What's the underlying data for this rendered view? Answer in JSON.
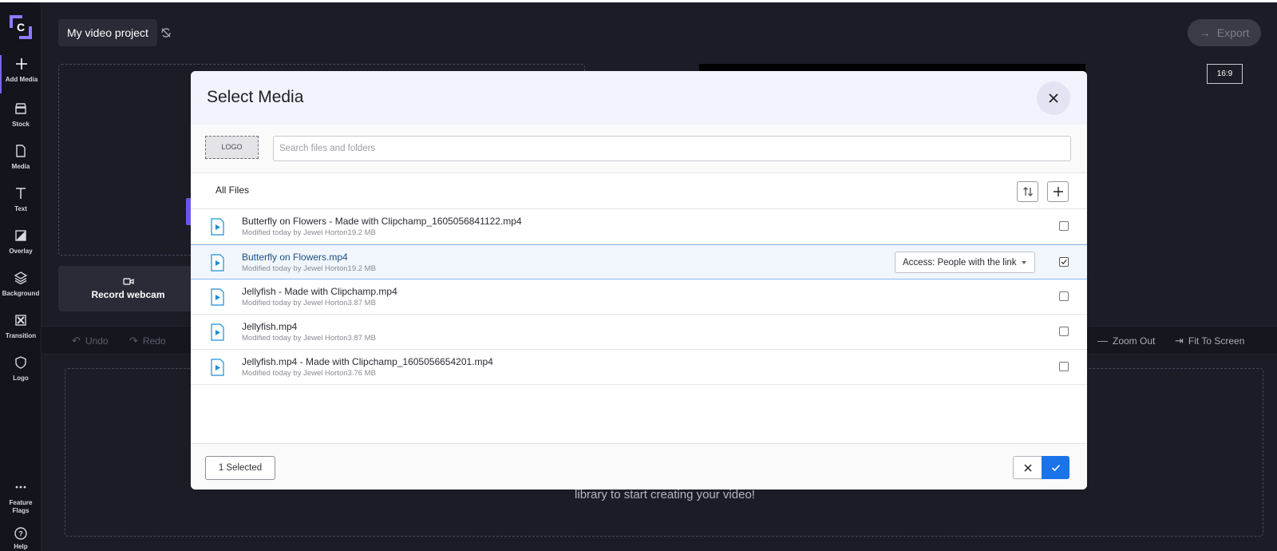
{
  "app": {
    "project_title": "My video project",
    "export_label": "Export",
    "aspect_ratio": "16:9",
    "accent_color": "#7b61ff"
  },
  "sidebar": {
    "items": [
      {
        "label": "Add Media",
        "icon": "plus-icon"
      },
      {
        "label": "Stock",
        "icon": "stock-icon"
      },
      {
        "label": "Media",
        "icon": "file-icon"
      },
      {
        "label": "Text",
        "icon": "text-icon"
      },
      {
        "label": "Overlay",
        "icon": "overlay-icon"
      },
      {
        "label": "Background",
        "icon": "layers-icon"
      },
      {
        "label": "Transition",
        "icon": "transition-icon"
      },
      {
        "label": "Logo",
        "icon": "shield-icon"
      }
    ],
    "feature_flags_label": "Feature Flags",
    "help_label": "Help"
  },
  "workspace": {
    "record_webcam_label": "Record webcam",
    "toolbar": {
      "undo": "Undo",
      "redo": "Redo",
      "zoom_out": "Zoom Out",
      "fit_to_screen": "Fit To Screen"
    },
    "timeline_hint": "library to start creating your video!"
  },
  "modal": {
    "title": "Select Media",
    "logo_placeholder": "LOGO",
    "search_placeholder": "Search files and folders",
    "breadcrumb": "All Files",
    "files": [
      {
        "name": "Butterfly on Flowers - Made with Clipchamp_1605056841122.mp4",
        "meta": "Modified today by Jewel Horton19.2 MB",
        "checked": false
      },
      {
        "name": "Butterfly on Flowers.mp4",
        "meta": "Modified today by Jewel Horton19.2 MB",
        "checked": true,
        "access": "Access: People with the link"
      },
      {
        "name": "Jellyfish - Made with Clipchamp.mp4",
        "meta": "Modified today by Jewel Horton3.87 MB",
        "checked": false
      },
      {
        "name": "Jellyfish.mp4",
        "meta": "Modified today by Jewel Horton3.87 MB",
        "checked": false
      },
      {
        "name": "Jellyfish.mp4 - Made with Clipchamp_1605056654201.mp4",
        "meta": "Modified today by Jewel Horton3.76 MB",
        "checked": false
      }
    ],
    "selected_count": "1 Selected",
    "confirm_color": "#1a73e8"
  }
}
